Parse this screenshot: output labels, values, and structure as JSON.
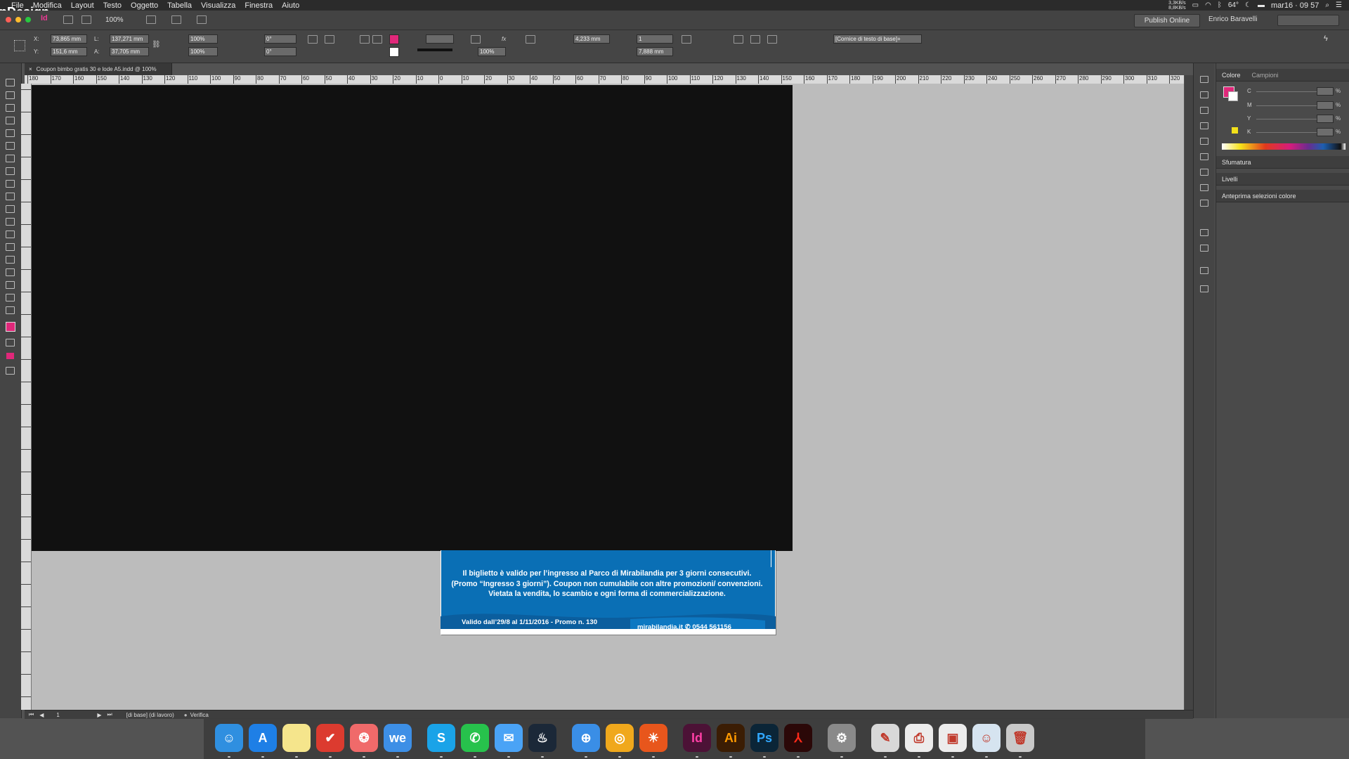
{
  "menubar": {
    "app_name": "InDesign CC",
    "items": [
      "File",
      "Modifica",
      "Layout",
      "Testo",
      "Oggetto",
      "Tabella",
      "Visualizza",
      "Finestra",
      "Aiuto"
    ],
    "battery": "64°",
    "datetime": "mar16 · 09 57",
    "net_up": "3,3KB/s",
    "net_down": "8,8KB/s"
  },
  "appbar": {
    "zoom": "100%",
    "publish_label": "Publish Online",
    "user_name": "Enrico Baravelli"
  },
  "control": {
    "x_label": "X:",
    "x_value": "73,865 mm",
    "y_label": "Y:",
    "y_value": "151,6 mm",
    "w_label": "L:",
    "w_value": "137,271 mm",
    "h_label": "A:",
    "h_value": "37,705 mm",
    "scale_x": "100%",
    "scale_y": "100%",
    "angle": "0°",
    "shear": "0°",
    "stroke_weight": "",
    "opacity": "100%",
    "frame_offset": "4,233 mm",
    "columns": "1",
    "gutter": "7,888 mm",
    "object_style": "[Cornice di testo di base]+"
  },
  "document": {
    "tab_title": "Coupon bimbo gratis 30 e lode A5.indd @ 100%",
    "coupon_text": "Il biglietto è valido per l’ingresso al Parco di Mirabilandia per 3 giorni consecutivi. (Promo “Ingresso 3 giorni”). Coupon non cumulabile con altre promozioni/ convenzioni. Vietata la vendita, lo scambio e ogni forma di commercializzazione.",
    "valid_text": "Valido dall’29/8 al 1/11/2016 - Promo n. 130",
    "site_text": "mirabilandia.it  ✆ 0544 561156"
  },
  "ruler_labels": [
    "180",
    "170",
    "160",
    "150",
    "140",
    "130",
    "120",
    "110",
    "100",
    "90",
    "80",
    "70",
    "60",
    "50",
    "40",
    "30",
    "20",
    "10",
    "0",
    "10",
    "20",
    "30",
    "40",
    "50",
    "60",
    "70",
    "80",
    "90",
    "100",
    "110",
    "120",
    "130",
    "140",
    "150",
    "160",
    "170",
    "180",
    "190",
    "200",
    "210",
    "220",
    "230",
    "240",
    "250",
    "260",
    "270",
    "280",
    "290",
    "300",
    "310",
    "320"
  ],
  "statusbar": {
    "page": "1",
    "master": "[di base] (di lavoro)",
    "preflight": "Verifica"
  },
  "panels": {
    "color_tab": "Colore",
    "swatches_tab": "Campioni",
    "channels": [
      "C",
      "M",
      "Y",
      "K"
    ],
    "pct": "%",
    "gradient": "Sfumatura",
    "layers": "Livelli",
    "separations": "Anteprima selezioni colore"
  },
  "colors": {
    "coupon_blue": "#0a6fb5",
    "fill_swatch": "#e0287a",
    "yellow_swatch": "#f2e01a"
  },
  "dock_apps": [
    {
      "name": "Finder",
      "color": "#2f8fe0",
      "glyph": "☺"
    },
    {
      "name": "App Store",
      "color": "#1e7fe6",
      "glyph": "A"
    },
    {
      "name": "Notes",
      "color": "#f5e58c",
      "glyph": ""
    },
    {
      "name": "Wunderlist",
      "color": "#dc3b2f",
      "glyph": "✔"
    },
    {
      "name": "Asana",
      "color": "#f06a6a",
      "glyph": "❂"
    },
    {
      "name": "WeTransfer",
      "color": "#3d8fe6",
      "glyph": "we"
    },
    {
      "name": "Skype",
      "color": "#1aa3e8",
      "glyph": "S"
    },
    {
      "name": "WhatsApp",
      "color": "#27c24c",
      "glyph": "✆"
    },
    {
      "name": "Messenger",
      "color": "#4aa3f6",
      "glyph": "✉"
    },
    {
      "name": "Steam",
      "color": "#1b2838",
      "glyph": "♨"
    },
    {
      "name": "Safari",
      "color": "#3a8ee6",
      "glyph": "⊕"
    },
    {
      "name": "Chrome",
      "color": "#f0a81c",
      "glyph": "◎"
    },
    {
      "name": "Firefox",
      "color": "#e8561c",
      "glyph": "☀"
    },
    {
      "name": "InDesign",
      "color": "#4c1236",
      "glyph": "Id"
    },
    {
      "name": "Illustrator",
      "color": "#3b1d04",
      "glyph": "Ai"
    },
    {
      "name": "Photoshop",
      "color": "#0b2537",
      "glyph": "Ps"
    },
    {
      "name": "Acrobat",
      "color": "#2b0808",
      "glyph": "⅄"
    },
    {
      "name": "System Preferences",
      "color": "#8a8a8a",
      "glyph": "⚙"
    },
    {
      "name": "Acrobat Tools",
      "color": "#d8d8d8",
      "glyph": "✎"
    },
    {
      "name": "Print Center",
      "color": "#ececec",
      "glyph": "⎙"
    },
    {
      "name": "Adobe PDF",
      "color": "#ececec",
      "glyph": "▣"
    },
    {
      "name": "Preview",
      "color": "#d6e4f0",
      "glyph": "☺"
    },
    {
      "name": "Trash",
      "color": "#c9c9c9",
      "glyph": "🗑"
    }
  ]
}
